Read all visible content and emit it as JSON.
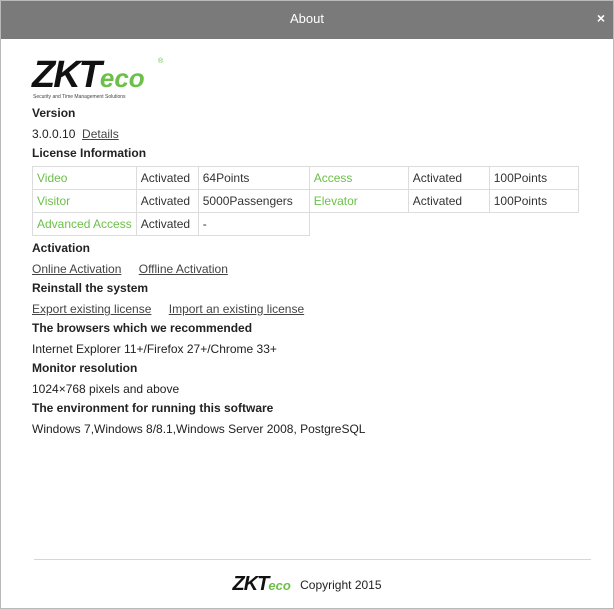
{
  "window": {
    "title": "About",
    "close_symbol": "×"
  },
  "logo": {
    "brand_main": "ZKT",
    "brand_eco": "eco",
    "registered": "®",
    "tagline": "Security and Time Management Solutions"
  },
  "version": {
    "heading": "Version",
    "number": "3.0.0.10",
    "details_link": "Details"
  },
  "license": {
    "heading": "License Information",
    "rows": [
      {
        "left": {
          "feature": "Video",
          "status": "Activated",
          "amount": "64Points"
        },
        "right": {
          "feature": "Access",
          "status": "Activated",
          "amount": "100Points"
        }
      },
      {
        "left": {
          "feature": "Visitor",
          "status": "Activated",
          "amount": "5000Passengers"
        },
        "right": {
          "feature": "Elevator",
          "status": "Activated",
          "amount": "100Points"
        }
      },
      {
        "left": {
          "feature": "Advanced Access",
          "status": "Activated",
          "amount": "-"
        }
      }
    ]
  },
  "activation": {
    "heading": "Activation",
    "online_link": "Online Activation",
    "offline_link": "Offline Activation"
  },
  "reinstall": {
    "heading": "Reinstall the system",
    "export_link": "Export existing license",
    "import_link": "Import an existing license"
  },
  "browsers": {
    "heading": "The browsers which we recommended",
    "text": "Internet Explorer 11+/Firefox 27+/Chrome 33+"
  },
  "monitor": {
    "heading": "Monitor resolution",
    "text": "1024×768 pixels and above"
  },
  "environment": {
    "heading": "The environment for running this software",
    "text": "Windows 7,Windows 8/8.1,Windows Server 2008, PostgreSQL"
  },
  "footer": {
    "brand_main": "ZKT",
    "brand_eco": "eco",
    "copyright": "Copyright 2015"
  },
  "colors": {
    "titlebar": "#7a7a7a",
    "accent_green": "#6cc04a"
  }
}
